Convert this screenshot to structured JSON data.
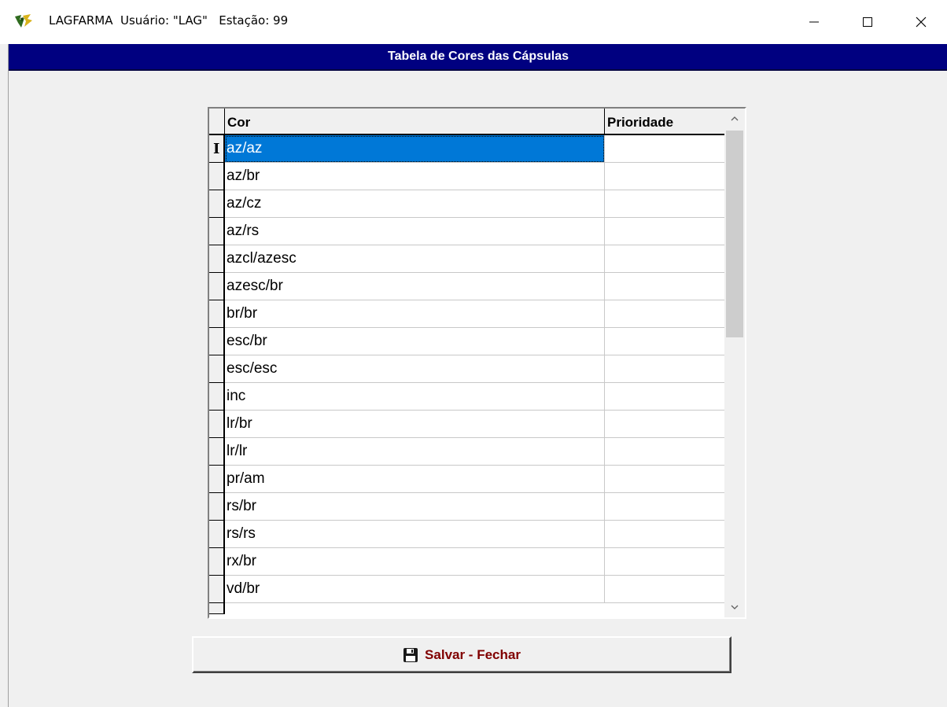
{
  "window": {
    "title": "LAGFARMA  Usuário: \"LAG\"   Estação: 99",
    "icon": "lagfarma-logo-icon"
  },
  "header": {
    "title": "Tabela de Cores das Cápsulas",
    "background": "#000080"
  },
  "grid": {
    "columns": [
      "Cor",
      "Prioridade"
    ],
    "selected_index": 0,
    "selection_color": "#0078d7",
    "rows": [
      {
        "cor": "az/az",
        "prioridade": ""
      },
      {
        "cor": "az/br",
        "prioridade": ""
      },
      {
        "cor": "az/cz",
        "prioridade": ""
      },
      {
        "cor": "az/rs",
        "prioridade": ""
      },
      {
        "cor": "azcl/azesc",
        "prioridade": ""
      },
      {
        "cor": "azesc/br",
        "prioridade": ""
      },
      {
        "cor": "br/br",
        "prioridade": ""
      },
      {
        "cor": "esc/br",
        "prioridade": ""
      },
      {
        "cor": "esc/esc",
        "prioridade": ""
      },
      {
        "cor": "inc",
        "prioridade": ""
      },
      {
        "cor": "lr/br",
        "prioridade": ""
      },
      {
        "cor": "lr/lr",
        "prioridade": ""
      },
      {
        "cor": "pr/am",
        "prioridade": ""
      },
      {
        "cor": "rs/br",
        "prioridade": ""
      },
      {
        "cor": "rs/rs",
        "prioridade": ""
      },
      {
        "cor": "rx/br",
        "prioridade": ""
      },
      {
        "cor": "vd/br",
        "prioridade": ""
      }
    ],
    "row_cursor_glyph": "I"
  },
  "save_button": {
    "label": "Salvar - Fechar",
    "icon": "floppy-disk-icon",
    "color": "#800000"
  }
}
